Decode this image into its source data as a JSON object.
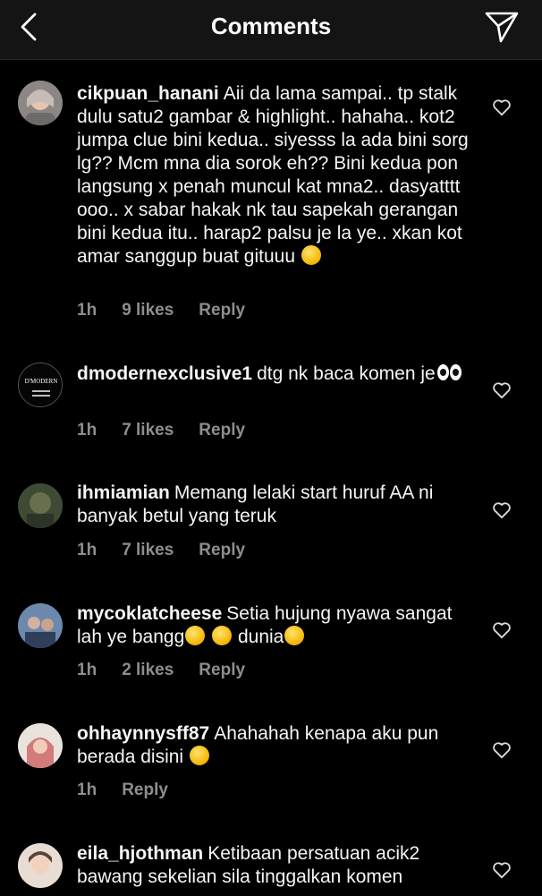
{
  "header": {
    "title": "Comments",
    "back_icon": "chevron-left-icon",
    "direct_icon": "paper-plane-icon"
  },
  "comments": [
    {
      "username": "cikpuan_hanani",
      "text": "Aii da lama sampai.. tp stalk dulu satu2 gambar & highlight.. hahaha.. kot2 jumpa clue bini kedua.. siyesss la ada bini sorg lg?? Mcm mna dia sorok eh?? Bini kedua pon langsung x penah muncul kat mna2.. dasyatttt ooo.. x sabar hakak nk tau sapekah gerangan bini kedua itu.. harap2 palsu je la ye.. xkan kot amar sanggup buat gituuu",
      "emoji": "grinning-face",
      "time": "1h",
      "likes": "9 likes",
      "reply": "Reply",
      "avatar_color": "#9a8f8a"
    },
    {
      "username": "dmodernexclusive1",
      "text": "dtg nk baca komen je",
      "emoji": "eyes",
      "time": "1h",
      "likes": "7 likes",
      "reply": "Reply",
      "avatar_text": "D'MODERN"
    },
    {
      "username": "ihmiamian",
      "text": "Memang lelaki start huruf AA ni banyak betul yang teruk",
      "emoji": "",
      "time": "1h",
      "likes": "7 likes",
      "reply": "Reply",
      "avatar_color": "#4d5a3e"
    },
    {
      "username": "mycoklatcheese",
      "text_parts": [
        "Setia hujung nyawa sangat lah ye bangg",
        " dunia"
      ],
      "emoji": "tears-of-joy",
      "time": "1h",
      "likes": "2 likes",
      "reply": "Reply",
      "avatar_color": "#3c5a8a"
    },
    {
      "username": "ohhaynnysff87",
      "text": "Ahahahah kenapa aku pun berada disini",
      "emoji": "tears-of-joy",
      "time": "1h",
      "likes": "",
      "reply": "Reply",
      "avatar_color": "#c9a08f"
    },
    {
      "username": "eila_hjothman",
      "text": "Ketibaan persatuan acik2 bawang sekelian sila tinggalkan komen",
      "emoji": "",
      "time": "",
      "likes": "",
      "reply": "",
      "avatar_color": "#d8c3b4"
    }
  ],
  "colors": {
    "background": "#000000",
    "header_bg": "#141414",
    "meta_gray": "#8e8e8e"
  }
}
